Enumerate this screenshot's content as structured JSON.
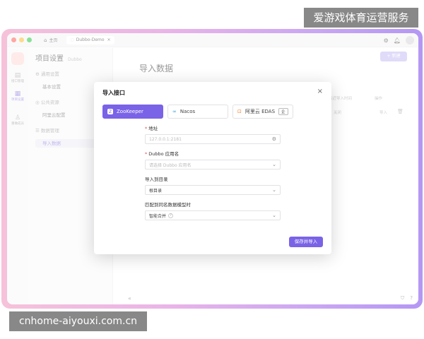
{
  "watermarks": {
    "top": "爱游戏体育运营服务",
    "bottom": "cnhome-aiyouxi.com.cn"
  },
  "titlebar": {
    "home_tab": "主页",
    "doc_tab": "Dubbo-Demo",
    "doc_tab_close": "×"
  },
  "leftbar": {
    "items": [
      {
        "label": "接口管理",
        "icon": "api-icon"
      },
      {
        "label": "项目设置",
        "icon": "settings-grid-icon"
      },
      {
        "label": "重做成员",
        "icon": "member-icon"
      }
    ]
  },
  "sidemenu": {
    "title": "项目设置",
    "subtitle": "Dubbo",
    "groups": [
      {
        "label": "通用设置",
        "items": [
          "基本设置"
        ]
      },
      {
        "label": "公共资源",
        "items": [
          "阿里云配置"
        ]
      },
      {
        "label": "数据管理",
        "items": [
          "导入数据"
        ]
      }
    ]
  },
  "main": {
    "title": "导入数据",
    "new_button": "+ 新建",
    "bg_col_last_import": "最近导入时间",
    "bg_col_action": "操作",
    "bg_cell_status": "关闭",
    "bg_cell_import": "导入"
  },
  "dialog": {
    "title": "导入接口",
    "close": "×",
    "sources": [
      {
        "label": "ZooKeeper",
        "active": true
      },
      {
        "label": "Nacos",
        "active": false
      },
      {
        "label": "阿里云 EDAS",
        "active": false,
        "badge": "企"
      }
    ],
    "fields": {
      "address_label": "地址",
      "address_placeholder": "127.0.0.1:2181",
      "app_label": "Dubbo 应用名",
      "app_placeholder": "请选择 Dubbo 应用名",
      "target_label": "导入到目录",
      "target_value": "根目录",
      "match_label": "匹配到同名数据模型时",
      "match_value": "智能合并"
    },
    "submit": "保存并导入"
  },
  "colors": {
    "accent": "#7a63e6",
    "frame_gradient_start": "#f6c2d9",
    "frame_gradient_end": "#b497f4"
  }
}
